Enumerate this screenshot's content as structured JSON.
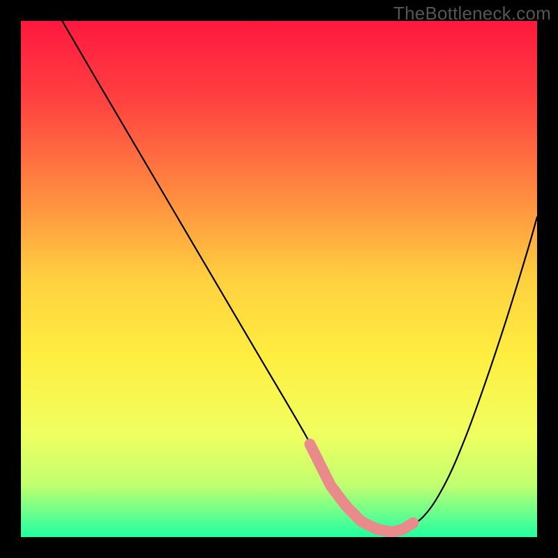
{
  "watermark": "TheBottleneck.com",
  "chart_data": {
    "type": "line",
    "title": "",
    "xlabel": "",
    "ylabel": "",
    "xlim": [
      0,
      100
    ],
    "ylim": [
      0,
      100
    ],
    "series": [
      {
        "name": "curve",
        "x": [
          8,
          15,
          25,
          35,
          45,
          55,
          58,
          60,
          63,
          66,
          69,
          72,
          74,
          78,
          82,
          86,
          90,
          94,
          98,
          100
        ],
        "y": [
          100,
          88,
          71,
          54,
          37,
          20,
          14,
          10,
          6,
          3,
          1.5,
          1,
          1.5,
          4,
          10,
          19,
          30,
          42,
          55,
          62
        ]
      }
    ],
    "highlight_segments": [
      {
        "from_x": 56,
        "to_x": 61
      },
      {
        "from_x": 61,
        "to_x": 73
      },
      {
        "from_x": 73,
        "to_x": 76
      }
    ],
    "gradient_stops": [
      {
        "offset": 0.0,
        "color": "#ff183f"
      },
      {
        "offset": 0.15,
        "color": "#ff4040"
      },
      {
        "offset": 0.35,
        "color": "#ff9040"
      },
      {
        "offset": 0.5,
        "color": "#ffd040"
      },
      {
        "offset": 0.65,
        "color": "#ffee40"
      },
      {
        "offset": 0.8,
        "color": "#f0ff60"
      },
      {
        "offset": 0.9,
        "color": "#c0ff70"
      },
      {
        "offset": 0.96,
        "color": "#60ff90"
      },
      {
        "offset": 1.0,
        "color": "#20ffa0"
      }
    ]
  }
}
